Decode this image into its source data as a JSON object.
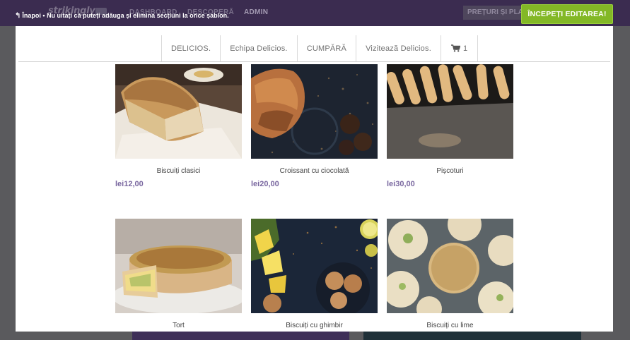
{
  "topbar": {
    "logo": "strikingly",
    "nav_dashboard": "DASHBOARD",
    "nav_discover": "DESCOPERĂ",
    "nav_admin": "ADMIN",
    "pricing": "PREȚURI ȘI PLANURI",
    "back_label": "Înapoi",
    "notice": "Nu uitați că puteți adăuga și elimina secțiuni la orice șablon.",
    "start_button": "ÎNCEPEȚI EDITAREA!"
  },
  "site_nav": {
    "items": [
      "DELICIOS.",
      "Echipa Delicios.",
      "CUMPĂRĂ",
      "Vizitează Delicios."
    ],
    "cart_count": "1"
  },
  "products": [
    {
      "name": "Biscuiți clasici",
      "price": "lei12,00"
    },
    {
      "name": "Croissant cu ciocolată",
      "price": "lei20,00"
    },
    {
      "name": "Pișcoturi",
      "price": "lei30,00"
    },
    {
      "name": "Tort",
      "price": ""
    },
    {
      "name": "Biscuiți cu ghimbir",
      "price": ""
    },
    {
      "name": "Biscuiți cu lime",
      "price": ""
    }
  ],
  "colors": {
    "accent": "#83b826",
    "price": "#7a68a0",
    "topbar": "#3b2c50"
  }
}
